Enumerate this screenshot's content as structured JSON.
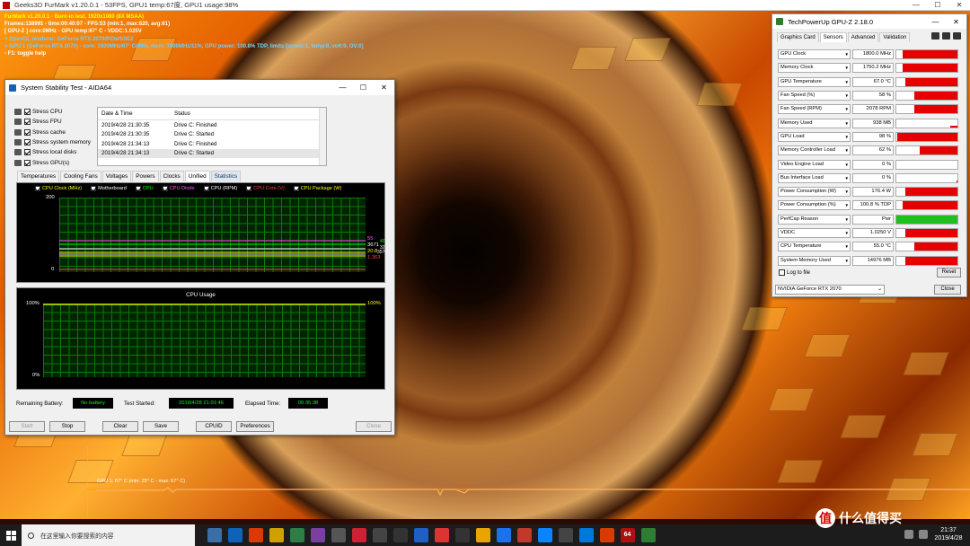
{
  "furmark": {
    "window_title": "Geeks3D FurMark v1.20.0.1 - 53FPS, GPU1 temp:67度, GPU1 usage:98%",
    "overlay": [
      {
        "text": "FurMark v1.20.0.1 - Burn-in test, 1920x1080 (8X MSAA)",
        "color": "#ffff00"
      },
      {
        "text": "Frames:138991 - time:00:40:07 - FPS:53 (min:1, max:820, avg:61)",
        "color": "#ffffff"
      },
      {
        "text": "[ GPU-Z ] core:0MHz - GPU temp:67° C - VDDC:1.025V",
        "color": "#ffffff"
      },
      {
        "text": "> OpenGL renderer: GeForce RTX 2070/PCIe/SSE2",
        "color": "#6fd0ff"
      },
      {
        "text": "> GPU 1 (GeForce RTX 2070) - core: 1800MHz/67° C/98%, mem: 7000MHz/11%, GPU power: 100.8% TDP, limits:[power:1, temp:0, volt:0, OV:0]",
        "color": "#6fd0ff"
      },
      {
        "text": "- F1: toggle help",
        "color": "#ffffff"
      }
    ],
    "temp_graph_label": "GPU 1: 67° C (min: 25° C - max: 67° C)"
  },
  "aida": {
    "title": "System Stability Test - AIDA64",
    "stress_items": [
      {
        "label": "Stress CPU",
        "checked": true
      },
      {
        "label": "Stress FPU",
        "checked": true
      },
      {
        "label": "Stress cache",
        "checked": true
      },
      {
        "label": "Stress system memory",
        "checked": true
      },
      {
        "label": "Stress local disks",
        "checked": true
      },
      {
        "label": "Stress GPU(s)",
        "checked": true
      }
    ],
    "log_headers": {
      "date": "Date & Time",
      "status": "Status"
    },
    "log_rows": [
      {
        "date": "2019/4/28 21:30:35",
        "status": "Drive C: Finished"
      },
      {
        "date": "2019/4/28 21:30:35",
        "status": "Drive C: Started"
      },
      {
        "date": "2019/4/28 21:34:13",
        "status": "Drive C: Finished"
      },
      {
        "date": "2019/4/28 21:34:13",
        "status": "Drive C: Started"
      }
    ],
    "tabs": [
      "Temperatures",
      "Cooling Fans",
      "Voltages",
      "Powers",
      "Clocks",
      "Unified",
      "Statistics"
    ],
    "legend": [
      {
        "label": "CPU Clock (MHz)",
        "color": "#ffff00"
      },
      {
        "label": "Motherboard",
        "color": "#ffffff"
      },
      {
        "label": "CPU",
        "color": "#00ff00"
      },
      {
        "label": "CPU Diode",
        "color": "#ff55ff"
      },
      {
        "label": "CPU (RPM)",
        "color": "#ffffff"
      },
      {
        "label": "CPU Core (V)",
        "color": "#ff4040"
      },
      {
        "label": "CPU Package (W)",
        "color": "#ffff00"
      }
    ],
    "graph1": {
      "ymax": "200",
      "ymin": "0",
      "right_values": [
        {
          "text": "55",
          "color": "#ff55ff"
        },
        {
          "text": "3671",
          "color": "#ffffff"
        },
        {
          "text": "20.8",
          "color": "#ffff00"
        },
        {
          "text": "1.363",
          "color": "#ff4040"
        }
      ],
      "extra_values": [
        {
          "text": "40",
          "color": "#00ff00"
        },
        {
          "text": "32",
          "color": "#ffffff"
        },
        {
          "text": "3576",
          "color": "#ffffff"
        }
      ]
    },
    "graph2": {
      "title": "CPU Usage",
      "ymax": "100%",
      "ymin": "0%",
      "right_value": "100%"
    },
    "battery_label": "Remaining Battery:",
    "battery_value": "No battery",
    "started_label": "Test Started:",
    "started_value": "2019/4/28 21:01:46",
    "elapsed_label": "Elapsed Time:",
    "elapsed_value": "00:35:38",
    "buttons": {
      "start": "Start",
      "stop": "Stop",
      "clear": "Clear",
      "save": "Save",
      "cpuid": "CPUID",
      "preferences": "Preferences",
      "close": "Close"
    }
  },
  "gpuz": {
    "title": "TechPowerUp GPU-Z 2.18.0",
    "tabs": [
      "Graphics Card",
      "Sensors",
      "Advanced",
      "Validation"
    ],
    "sensors": [
      {
        "name": "GPU Clock",
        "value": "1800.0 MHz",
        "level": 0.9,
        "type": "red"
      },
      {
        "name": "Memory Clock",
        "value": "1750.2 MHz",
        "level": 0.9,
        "type": "red"
      },
      {
        "name": "GPU Temperature",
        "value": "67.0 °C",
        "level": 0.85,
        "type": "red"
      },
      {
        "name": "Fan Speed (%)",
        "value": "58 %",
        "level": 0.7,
        "type": "red"
      },
      {
        "name": "Fan Speed (RPM)",
        "value": "2078 RPM",
        "level": 0.7,
        "type": "red"
      },
      {
        "name": "Memory Used",
        "value": "938 MB",
        "level": 0.12,
        "type": "thin"
      },
      {
        "name": "GPU Load",
        "value": "98 %",
        "level": 0.98,
        "type": "red"
      },
      {
        "name": "Memory Controller Load",
        "value": "62 %",
        "level": 0.62,
        "type": "red"
      },
      {
        "name": "Video Engine Load",
        "value": "0 %",
        "level": 0,
        "type": "red"
      },
      {
        "name": "Bus Interface Load",
        "value": "0 %",
        "level": 0.02,
        "type": "thin"
      },
      {
        "name": "Power Consumption (W)",
        "value": "176.4 W",
        "level": 0.85,
        "type": "red"
      },
      {
        "name": "Power Consumption (%)",
        "value": "100.8 % TDP",
        "level": 0.9,
        "type": "red"
      },
      {
        "name": "PerfCap Reason",
        "value": "Pwr",
        "level": 1,
        "type": "green"
      },
      {
        "name": "VDDC",
        "value": "1.0250 V",
        "level": 0.85,
        "type": "red"
      },
      {
        "name": "CPU Temperature",
        "value": "55.0 °C",
        "level": 0.7,
        "type": "red"
      },
      {
        "name": "System Memory Used",
        "value": "14976 MB",
        "level": 0.85,
        "type": "red"
      }
    ],
    "log_label": "Log to file",
    "reset_label": "Reset",
    "device": "NVIDIA GeForce RTX 2070",
    "close_label": "Close"
  },
  "taskbar": {
    "search_placeholder": "在这里输入你要搜索的内容",
    "clock_time": "21:37",
    "clock_date": "2019/4/28",
    "watermark": "什么值得买",
    "watermark_badge": "值"
  }
}
